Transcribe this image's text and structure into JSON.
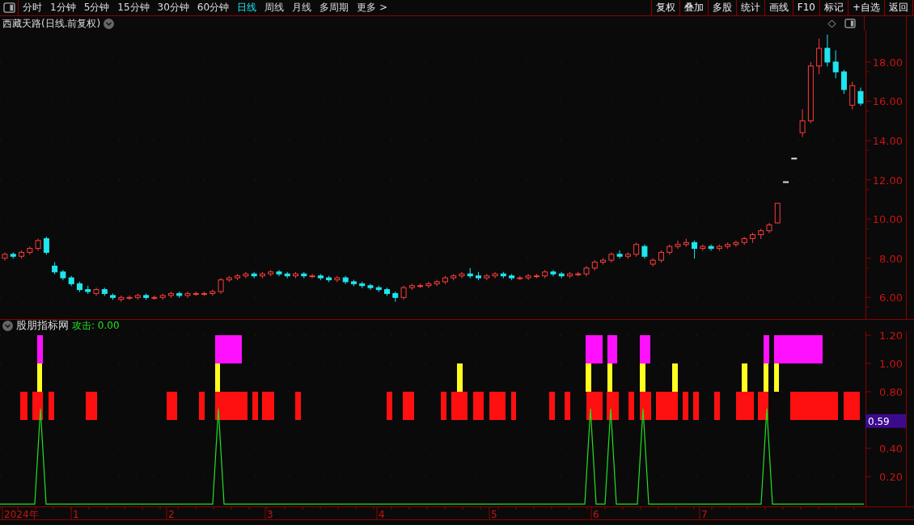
{
  "toolbar": {
    "periods": [
      {
        "label": "分时",
        "selected": false
      },
      {
        "label": "1分钟",
        "selected": false
      },
      {
        "label": "5分钟",
        "selected": false
      },
      {
        "label": "15分钟",
        "selected": false
      },
      {
        "label": "30分钟",
        "selected": false
      },
      {
        "label": "60分钟",
        "selected": false
      },
      {
        "label": "日线",
        "selected": true
      },
      {
        "label": "周线",
        "selected": false
      },
      {
        "label": "月线",
        "selected": false
      },
      {
        "label": "多周期",
        "selected": false
      },
      {
        "label": "更多 >",
        "selected": false
      }
    ],
    "actions": [
      "复权",
      "叠加",
      "多股",
      "统计",
      "画线",
      "F10",
      "标记",
      "+自选",
      "返回"
    ]
  },
  "price_chart": {
    "title": "西藏天路(日线.前复权)",
    "chart_data": {
      "type": "candlestick",
      "ylim": [
        4.9,
        19.6
      ],
      "yticks": [
        {
          "value": 18,
          "label": "18.00"
        },
        {
          "value": 16,
          "label": "16.00"
        },
        {
          "value": 14,
          "label": "14.00"
        },
        {
          "value": 12,
          "label": "12.00"
        },
        {
          "value": 10,
          "label": "10.00"
        },
        {
          "value": 8,
          "label": "8.00"
        },
        {
          "value": 6,
          "label": "6.00"
        }
      ],
      "grid": true,
      "ohlc": [
        [
          8.0,
          8.3,
          7.9,
          8.2
        ],
        [
          8.2,
          8.3,
          8.0,
          8.1
        ],
        [
          8.1,
          8.4,
          8.0,
          8.3
        ],
        [
          8.3,
          8.6,
          8.2,
          8.5
        ],
        [
          8.5,
          9.0,
          8.4,
          8.9
        ],
        [
          9.0,
          9.1,
          8.2,
          8.3
        ],
        [
          7.6,
          7.8,
          7.2,
          7.3
        ],
        [
          7.3,
          7.4,
          6.9,
          7.0
        ],
        [
          7.0,
          7.1,
          6.6,
          6.7
        ],
        [
          6.7,
          6.8,
          6.3,
          6.4
        ],
        [
          6.4,
          6.6,
          6.2,
          6.3
        ],
        [
          6.2,
          6.5,
          6.1,
          6.4
        ],
        [
          6.4,
          6.5,
          6.1,
          6.2
        ],
        [
          6.1,
          6.2,
          5.9,
          6.0
        ],
        [
          5.9,
          6.1,
          5.8,
          6.0
        ],
        [
          6.0,
          6.1,
          5.9,
          6.0
        ],
        [
          6.0,
          6.2,
          5.9,
          6.1
        ],
        [
          6.1,
          6.2,
          5.9,
          6.0
        ],
        [
          6.0,
          6.1,
          5.9,
          6.0
        ],
        [
          6.0,
          6.2,
          5.9,
          6.1
        ],
        [
          6.1,
          6.3,
          6.0,
          6.2
        ],
        [
          6.2,
          6.3,
          6.0,
          6.1
        ],
        [
          6.1,
          6.3,
          6.0,
          6.2
        ],
        [
          6.2,
          6.3,
          6.1,
          6.2
        ],
        [
          6.2,
          6.3,
          6.1,
          6.2
        ],
        [
          6.2,
          6.4,
          6.1,
          6.3
        ],
        [
          6.3,
          7.0,
          6.2,
          6.9
        ],
        [
          6.9,
          7.1,
          6.8,
          7.0
        ],
        [
          7.0,
          7.2,
          6.9,
          7.1
        ],
        [
          7.1,
          7.3,
          7.0,
          7.2
        ],
        [
          7.2,
          7.3,
          7.0,
          7.1
        ],
        [
          7.1,
          7.3,
          7.0,
          7.2
        ],
        [
          7.2,
          7.4,
          7.1,
          7.3
        ],
        [
          7.3,
          7.4,
          7.1,
          7.2
        ],
        [
          7.2,
          7.3,
          7.0,
          7.1
        ],
        [
          7.1,
          7.3,
          7.0,
          7.2
        ],
        [
          7.2,
          7.3,
          7.0,
          7.1
        ],
        [
          7.1,
          7.2,
          7.0,
          7.1
        ],
        [
          7.1,
          7.2,
          6.9,
          7.0
        ],
        [
          7.0,
          7.1,
          6.8,
          6.9
        ],
        [
          6.9,
          7.1,
          6.8,
          7.0
        ],
        [
          7.0,
          7.1,
          6.7,
          6.8
        ],
        [
          6.8,
          6.9,
          6.6,
          6.7
        ],
        [
          6.7,
          6.8,
          6.5,
          6.6
        ],
        [
          6.6,
          6.7,
          6.4,
          6.5
        ],
        [
          6.5,
          6.6,
          6.3,
          6.4
        ],
        [
          6.4,
          6.5,
          6.1,
          6.2
        ],
        [
          6.2,
          6.3,
          5.8,
          6.0
        ],
        [
          6.0,
          6.6,
          5.9,
          6.5
        ],
        [
          6.5,
          6.7,
          6.4,
          6.6
        ],
        [
          6.6,
          6.7,
          6.5,
          6.6
        ],
        [
          6.6,
          6.8,
          6.5,
          6.7
        ],
        [
          6.7,
          6.9,
          6.6,
          6.8
        ],
        [
          6.8,
          7.1,
          6.7,
          7.0
        ],
        [
          7.0,
          7.2,
          6.9,
          7.1
        ],
        [
          7.1,
          7.3,
          7.0,
          7.2
        ],
        [
          7.2,
          7.5,
          7.0,
          7.1
        ],
        [
          7.1,
          7.3,
          6.9,
          7.0
        ],
        [
          7.0,
          7.2,
          6.9,
          7.1
        ],
        [
          7.1,
          7.3,
          7.0,
          7.2
        ],
        [
          7.2,
          7.3,
          7.0,
          7.1
        ],
        [
          7.1,
          7.2,
          6.9,
          7.0
        ],
        [
          7.0,
          7.1,
          6.9,
          7.0
        ],
        [
          7.0,
          7.2,
          6.9,
          7.1
        ],
        [
          7.1,
          7.2,
          7.0,
          7.1
        ],
        [
          7.1,
          7.4,
          7.0,
          7.3
        ],
        [
          7.3,
          7.4,
          7.1,
          7.2
        ],
        [
          7.2,
          7.3,
          7.0,
          7.1
        ],
        [
          7.1,
          7.3,
          7.0,
          7.2
        ],
        [
          7.2,
          7.3,
          7.1,
          7.2
        ],
        [
          7.2,
          7.6,
          7.1,
          7.5
        ],
        [
          7.5,
          7.9,
          7.4,
          7.8
        ],
        [
          7.8,
          8.0,
          7.7,
          7.9
        ],
        [
          7.9,
          8.3,
          7.8,
          8.2
        ],
        [
          8.2,
          8.4,
          8.0,
          8.1
        ],
        [
          8.1,
          8.3,
          8.0,
          8.2
        ],
        [
          8.2,
          8.8,
          8.1,
          8.7
        ],
        [
          8.6,
          8.7,
          8.0,
          8.1
        ],
        [
          7.7,
          8.0,
          7.6,
          7.9
        ],
        [
          7.9,
          8.4,
          7.8,
          8.3
        ],
        [
          8.3,
          8.7,
          8.2,
          8.6
        ],
        [
          8.6,
          8.9,
          8.5,
          8.7
        ],
        [
          8.7,
          9.0,
          8.6,
          8.8
        ],
        [
          8.8,
          8.9,
          8.0,
          8.5
        ],
        [
          8.5,
          8.7,
          8.4,
          8.6
        ],
        [
          8.6,
          8.7,
          8.4,
          8.5
        ],
        [
          8.5,
          8.7,
          8.4,
          8.6
        ],
        [
          8.6,
          8.8,
          8.5,
          8.7
        ],
        [
          8.7,
          8.9,
          8.6,
          8.8
        ],
        [
          8.8,
          9.1,
          8.7,
          9.0
        ],
        [
          9.0,
          9.3,
          8.8,
          9.2
        ],
        [
          9.2,
          9.5,
          9.0,
          9.4
        ],
        [
          9.4,
          9.8,
          9.3,
          9.7
        ],
        [
          9.8,
          10.8,
          9.8,
          10.8
        ],
        [
          11.9,
          11.9,
          11.9,
          11.9
        ],
        [
          13.1,
          13.1,
          13.1,
          13.1
        ],
        [
          14.4,
          15.6,
          14.2,
          15.0
        ],
        [
          15.0,
          18.0,
          14.9,
          17.8
        ],
        [
          17.8,
          19.2,
          17.4,
          18.7
        ],
        [
          18.7,
          19.4,
          17.8,
          18.0
        ],
        [
          18.0,
          18.6,
          17.2,
          17.5
        ],
        [
          17.5,
          17.6,
          16.4,
          16.6
        ],
        [
          15.8,
          17.0,
          15.6,
          16.8
        ],
        [
          16.5,
          16.7,
          15.8,
          15.9
        ]
      ]
    }
  },
  "indicator": {
    "name": "股朋指标网",
    "readout": "攻击: 0.00",
    "axis_labels": [
      "1.20",
      "1.00",
      "0.80",
      "0.40",
      "0.20"
    ],
    "cursor_value": "0.59"
  },
  "date_axis": [
    "2024年",
    "1",
    "2",
    "3",
    "4",
    "5",
    "6",
    "7"
  ]
}
